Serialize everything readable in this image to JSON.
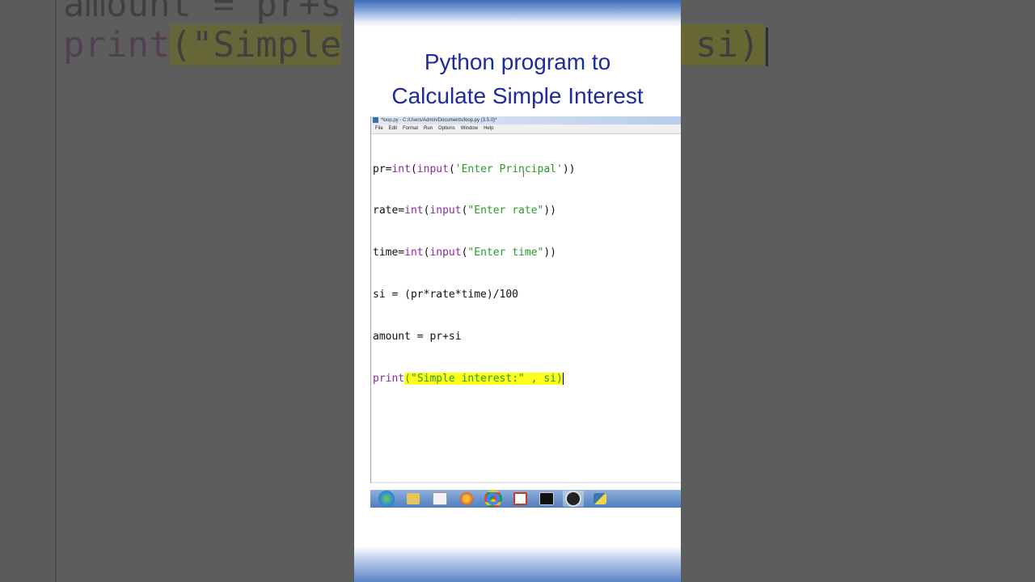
{
  "video_title": {
    "line1": "Python program to",
    "line2": "Calculate Simple Interest"
  },
  "idle_window": {
    "title": "*loop.py - C:/Users/Admin/Documents/loop.py (3.5.0)*",
    "menu": [
      "File",
      "Edit",
      "Format",
      "Run",
      "Options",
      "Window",
      "Help"
    ]
  },
  "code": {
    "line1": {
      "var": "pr=",
      "kw1": "int",
      "p1": "(",
      "kw2": "input",
      "p2": "(",
      "str": "'Enter Principal'",
      "end": "))"
    },
    "line2": {
      "var": "rate=",
      "kw1": "int",
      "p1": "(",
      "kw2": "input",
      "p2": "(",
      "str": "\"Enter rate\"",
      "end": "))"
    },
    "line3": {
      "var": "time=",
      "kw1": "int",
      "p1": "(",
      "kw2": "input",
      "p2": "(",
      "str": "\"Enter time\"",
      "end": "))"
    },
    "line4": "si = (pr*rate*time)/100",
    "line5": "amount = pr+si",
    "line6": {
      "kw": "print",
      "p1": "(",
      "str": "\"Simple interest:\"",
      "rest": " , si)"
    }
  },
  "background_code": {
    "line1": "amount = pr+s",
    "line2_kw": "print",
    "line2_hl": "(\"Simple",
    "right_hl": "si)"
  },
  "taskbar": {
    "icons": [
      "windows-start",
      "file-explorer",
      "media-player",
      "firefox",
      "chrome",
      "powerpoint",
      "command-prompt",
      "obs",
      "python-idle"
    ],
    "active": "obs"
  }
}
